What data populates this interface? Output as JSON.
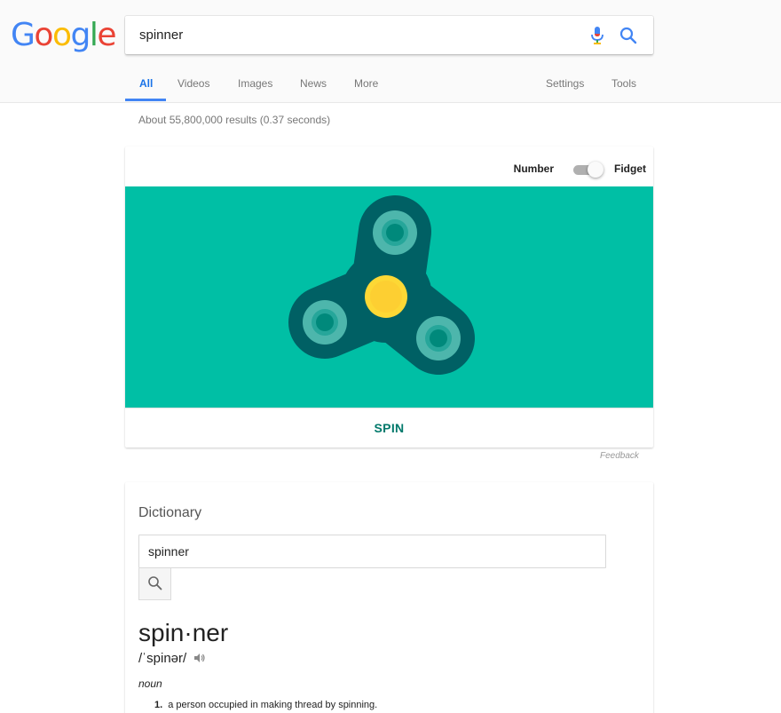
{
  "logo": {
    "g1": "G",
    "o1": "o",
    "o2": "o",
    "g2": "g",
    "l": "l",
    "e": "e"
  },
  "search": {
    "query": "spinner"
  },
  "tabs": [
    {
      "label": "All"
    },
    {
      "label": "Videos"
    },
    {
      "label": "Images"
    },
    {
      "label": "News"
    },
    {
      "label": "More"
    },
    {
      "label": "Settings"
    },
    {
      "label": "Tools"
    }
  ],
  "stats": "About 55,800,000 results (0.37 seconds)",
  "spinner_widget": {
    "toggle_left": "Number",
    "toggle_right": "Fidget",
    "spin_label": "SPIN",
    "background_color": "#00bfa5",
    "body_color": "#006064",
    "center_color": "#fdd835"
  },
  "feedback": "Feedback",
  "dictionary": {
    "title": "Dictionary",
    "input_value": "spinner",
    "word": "spin·ner",
    "pronunciation": "/ˈspinər/",
    "part_of_speech": "noun",
    "definitions": [
      {
        "number": "1.",
        "text": "a person occupied in making thread by spinning."
      }
    ]
  }
}
